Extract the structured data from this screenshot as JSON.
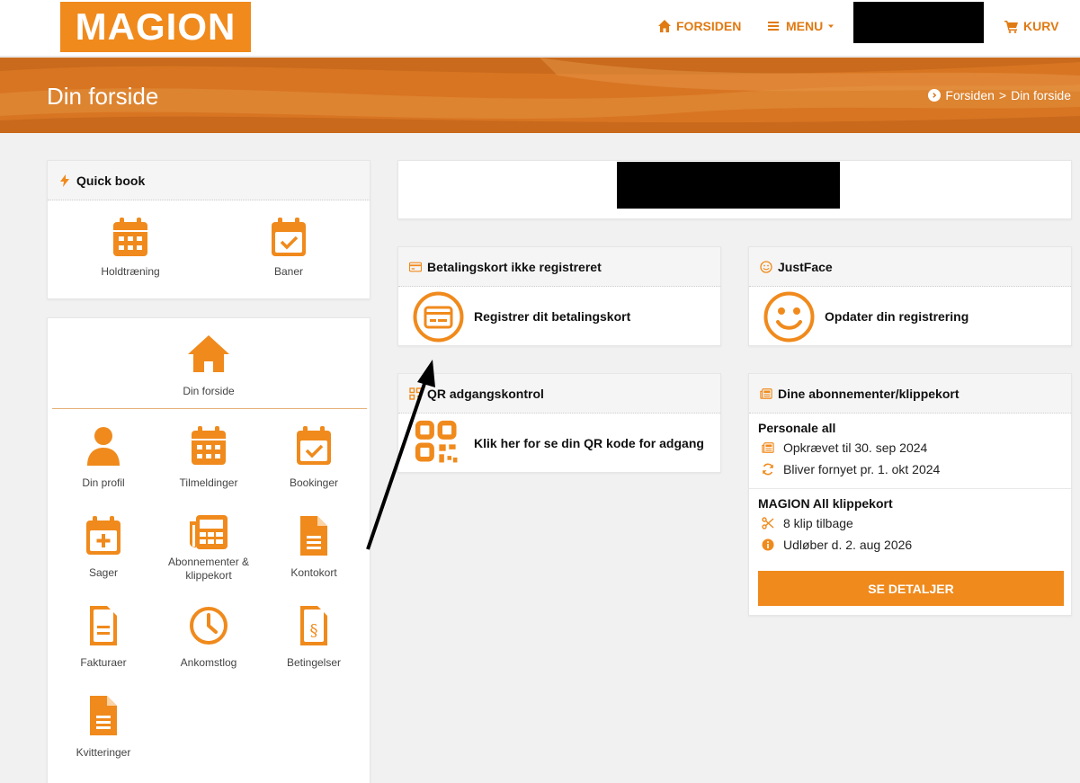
{
  "brand": {
    "logo_text": "MAGION",
    "accent": "#f08a1c"
  },
  "nav": {
    "home_label": "FORSIDEN",
    "menu_label": "MENU",
    "cart_label": "KURV"
  },
  "banner": {
    "title": "Din forside",
    "breadcrumb_home": "Forsiden",
    "breadcrumb_sep": ">",
    "breadcrumb_current": "Din forside"
  },
  "quickbook": {
    "title": "Quick book",
    "items": [
      {
        "label": "Holdtræning",
        "icon": "calendar-grid-icon"
      },
      {
        "label": "Baner",
        "icon": "calendar-check-icon"
      }
    ]
  },
  "sidemenu": {
    "home_label": "Din forside",
    "items": [
      {
        "label": "Din profil",
        "icon": "user-icon"
      },
      {
        "label": "Tilmeldinger",
        "icon": "calendar-grid-icon"
      },
      {
        "label": "Bookinger",
        "icon": "calendar-check-icon"
      },
      {
        "label": "Sager",
        "icon": "calendar-plus-icon"
      },
      {
        "label": "Abonnementer & klippekort",
        "icon": "newspaper-icon"
      },
      {
        "label": "Kontokort",
        "icon": "document-icon"
      },
      {
        "label": "Fakturaer",
        "icon": "invoice-icon"
      },
      {
        "label": "Ankomstlog",
        "icon": "clock-icon"
      },
      {
        "label": "Betingelser",
        "icon": "terms-document-icon"
      },
      {
        "label": "Kvitteringer",
        "icon": "receipt-icon"
      }
    ]
  },
  "payment_card": {
    "title": "Betalingskort ikke registreret",
    "action": "Registrer dit betalingskort"
  },
  "justface": {
    "title": "JustFace",
    "action": "Opdater din registrering"
  },
  "qr": {
    "title": "QR adgangskontrol",
    "action": "Klik her for se din QR kode for adgang"
  },
  "subscriptions": {
    "title": "Dine abonnementer/klippekort",
    "plans": [
      {
        "name": "Personale all",
        "line1": "Opkrævet til 30. sep 2024",
        "line2": "Bliver fornyet pr. 1. okt 2024"
      },
      {
        "name": "MAGION All klippekort",
        "line1": "8 klip tilbage",
        "line2": "Udløber d. 2. aug 2026"
      }
    ],
    "button_label": "SE DETALJER"
  }
}
